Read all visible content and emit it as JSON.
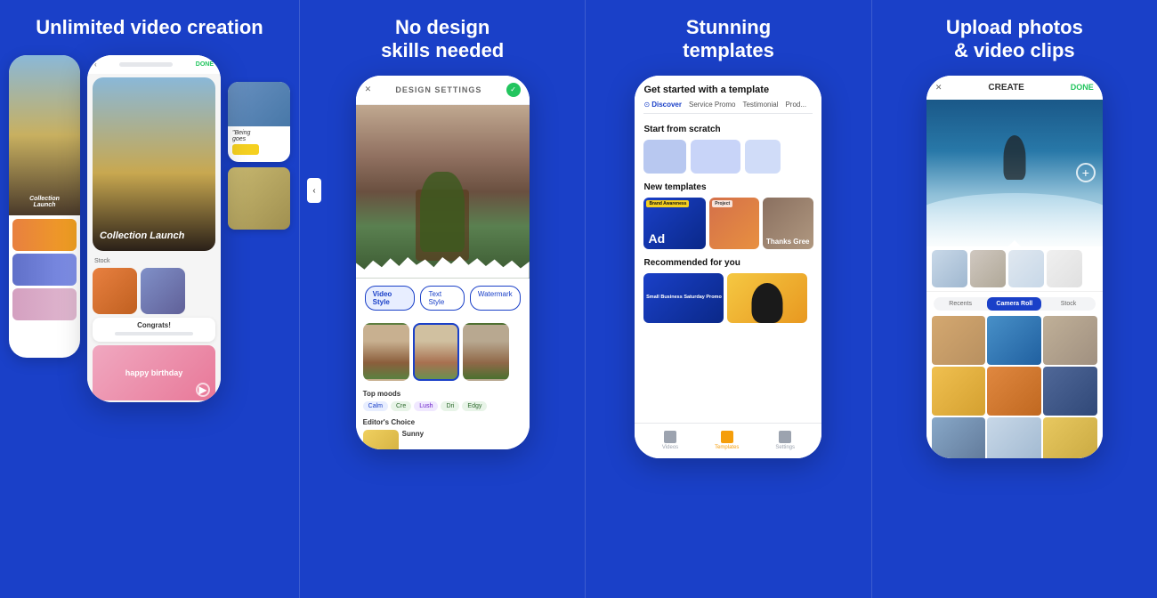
{
  "panels": [
    {
      "id": "panel-1",
      "title": "Unlimited\nvideo creation",
      "phone": {
        "header_label": "DONE",
        "main_card_text": "Collection\nLaunch",
        "bottom_label": "Stock",
        "congrats_text": "Congrats!",
        "birthday_text": "happy birthday"
      }
    },
    {
      "id": "panel-2",
      "title": "No design\nskills needed",
      "phone": {
        "header_title": "DESIGN SETTINGS",
        "style_tabs": [
          "Video Style",
          "Text Style",
          "Watermark"
        ],
        "moods_title": "Top moods",
        "moods": [
          "Calm",
          "Cre",
          "Lush",
          "Dri",
          "Edgy"
        ],
        "editors_choice": "Editor's Choice",
        "sunny_label": "Sunny"
      }
    },
    {
      "id": "panel-3",
      "title": "Stunning\ntemplates",
      "phone": {
        "header_title": "Get started with a template",
        "tabs": [
          "Discover",
          "Service Promo",
          "Testimonial",
          "Prod..."
        ],
        "section_scratch": "Start from scratch",
        "section_new": "New templates",
        "template_1_label": "Brand\nAwareness",
        "template_1_sub": "Ad",
        "template_3_text": "Thanks\nGree",
        "section_rec": "Recommended for you",
        "rec_1_text": "Small Business\nSaturday Promo",
        "nav_items": [
          "Videos",
          "Templates",
          "Settings"
        ]
      }
    },
    {
      "id": "panel-4",
      "title": "Upload photos\n& video clips",
      "phone": {
        "header_title": "CREATE",
        "done_label": "DONE",
        "filter_tabs": [
          "Recents",
          "Camera Roll",
          "Stock"
        ],
        "active_filter": "Camera Roll"
      }
    }
  ]
}
